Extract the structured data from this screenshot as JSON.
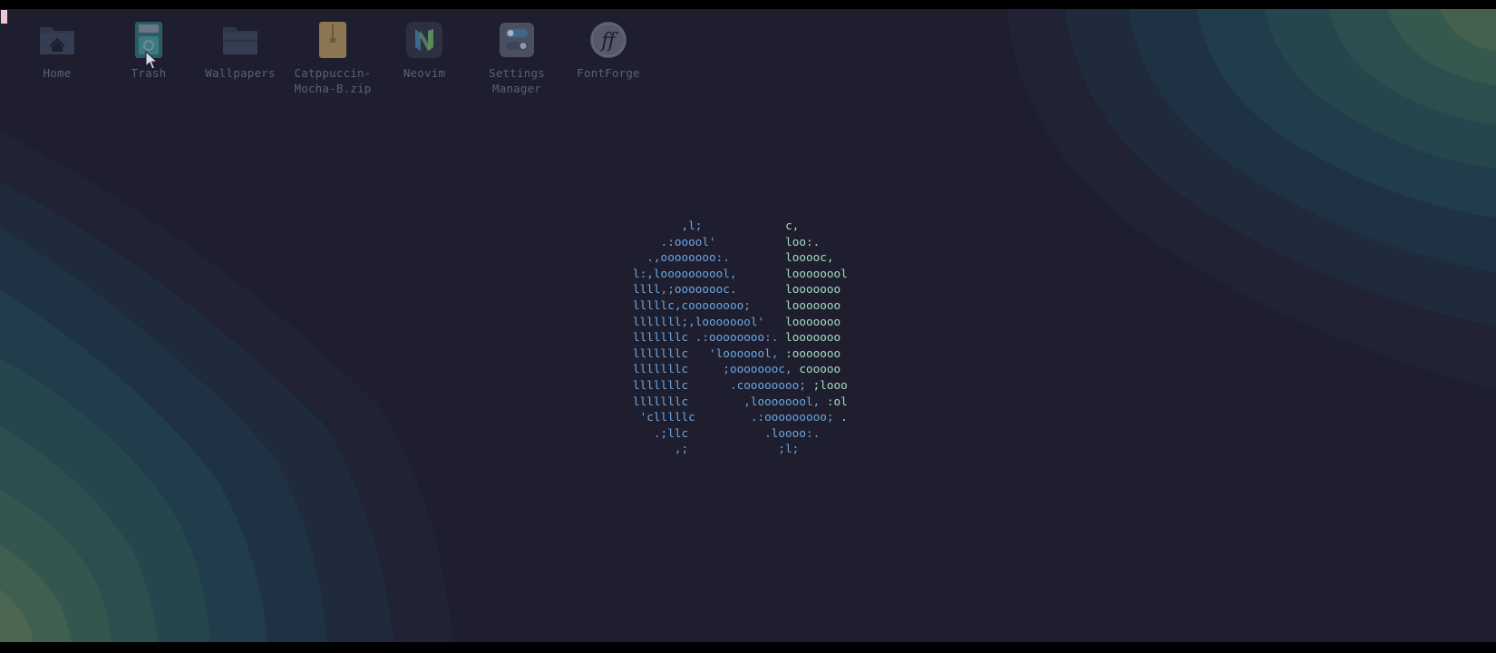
{
  "desktop": {
    "icons": [
      {
        "label": "Home",
        "icon": "home-folder-icon"
      },
      {
        "label": "Trash",
        "icon": "trash-icon"
      },
      {
        "label": "Wallpapers",
        "icon": "folder-icon"
      },
      {
        "label": "Catppuccin-\nMocha-B.zip",
        "icon": "zip-archive-icon"
      },
      {
        "label": "Neovim",
        "icon": "neovim-icon"
      },
      {
        "label": "Settings\nManager",
        "icon": "settings-manager-icon"
      },
      {
        "label": "FontForge",
        "icon": "fontforge-icon"
      }
    ]
  },
  "ascii_logo": {
    "left_lines": [
      "       ,l;",
      "    .:ooool'",
      "  .,oooooooo:.",
      "l:,loooooooool,",
      "llll,;oooooooc.",
      "lllllc,coooooooo;",
      "lllllll;,loooooool'",
      "lllllllc .:oooooooo:.",
      "lllllllc   'looooool,",
      "lllllllc     ;oooooooc,",
      "lllllllc      .coooooooo;",
      "lllllllc        ,loooooool,",
      " 'clllllc        .:ooooooooo;",
      "   .;llc           .loooo:.",
      "      ,;             ;l;"
    ],
    "right_lines": [
      "c,",
      "loo:.",
      "looooc,",
      "loooooool",
      "looooooo",
      "looooooo",
      "looooooo",
      "looooooo",
      ":ooooooo",
      "cooooo",
      ";looo",
      ":ol",
      ".",
      "",
      ""
    ]
  },
  "colors": {
    "background": "#1e1e2e",
    "logo_left": "#6ea6e0",
    "logo_right": "#a6dcc0",
    "label": "#5e6072",
    "cursor": "#f0c6d2"
  }
}
